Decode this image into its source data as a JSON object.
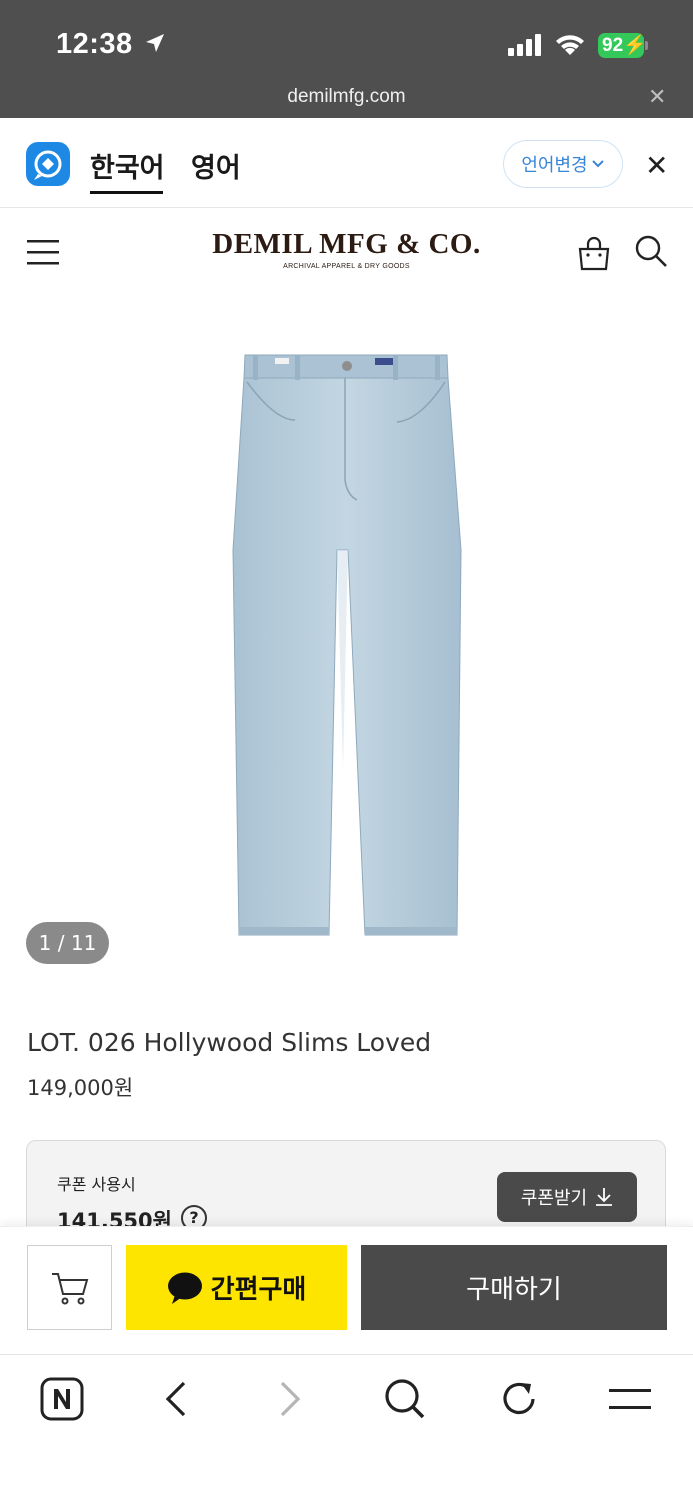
{
  "status_bar": {
    "time": "12:38",
    "battery": "92",
    "url": "demilmfg.com"
  },
  "translate_bar": {
    "language_korean": "한국어",
    "language_english": "영어",
    "change_language": "언어변경",
    "accent_color": "#3a86d6"
  },
  "header": {
    "logo_text": "DEMIL MFG & CO.",
    "logo_subtitle": "ARCHIVAL APPAREL & DRY GOODS"
  },
  "gallery": {
    "counter": "1 / 11"
  },
  "product": {
    "name": "LOT. 026 Hollywood Slims Loved",
    "price": "149,000원"
  },
  "coupon": {
    "label": "쿠폰 사용시",
    "price": "141,550원",
    "help": "?",
    "button": "쿠폰받기"
  },
  "purchase_bar": {
    "quick_buy": "간편구매",
    "buy": "구매하기",
    "quick_buy_color": "#fee500",
    "buy_color": "#4a4a4a"
  }
}
